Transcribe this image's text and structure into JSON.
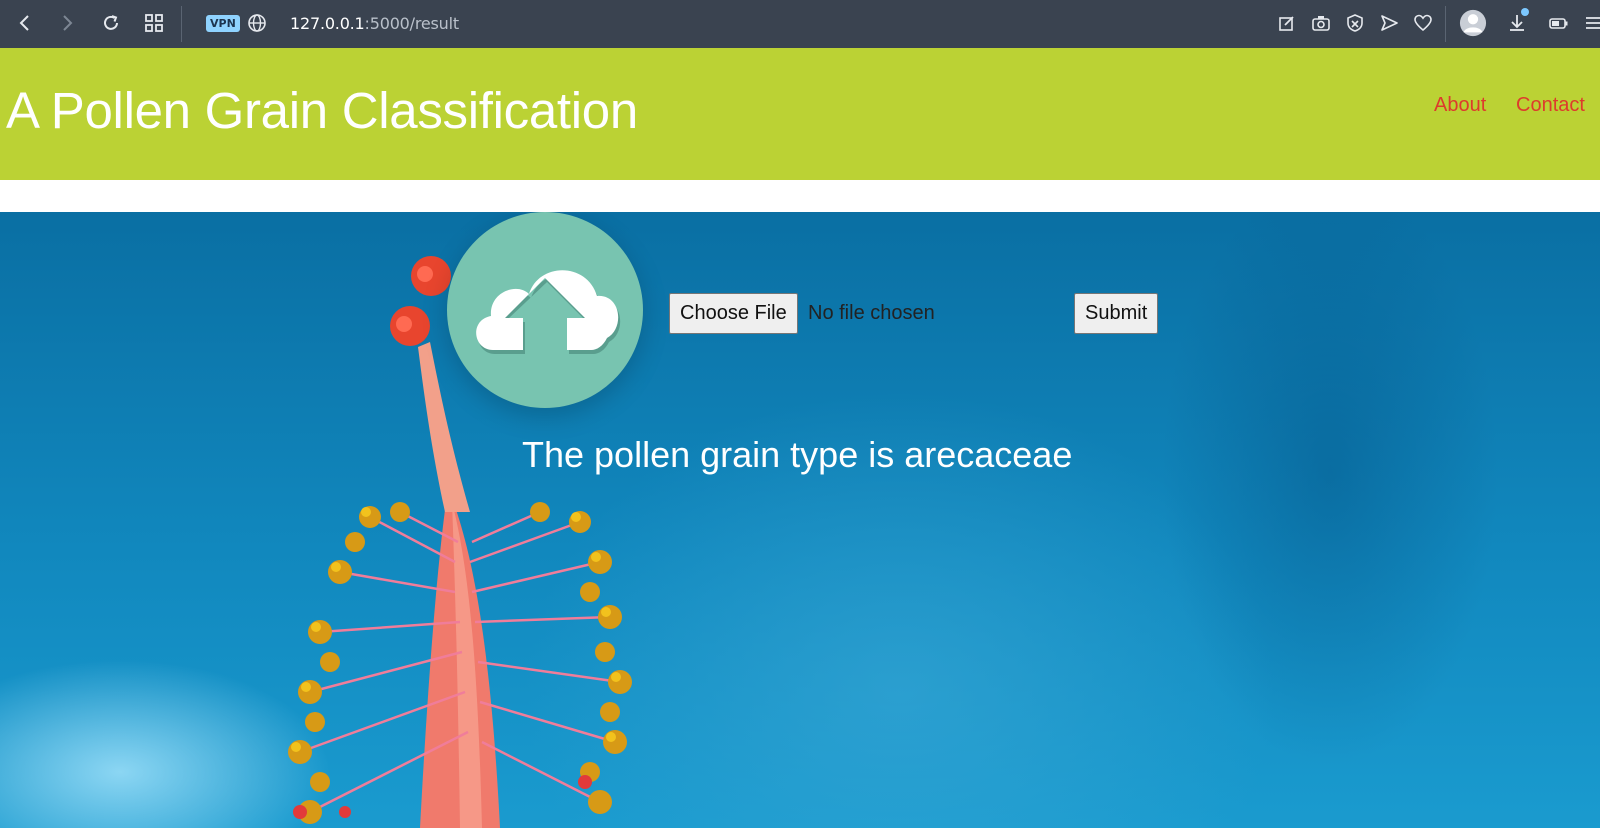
{
  "browser": {
    "vpn_label": "VPN",
    "url_host": "127.0.0.1",
    "url_rest": ":5000/result",
    "icons": [
      "back-icon",
      "forward-icon",
      "reload-icon",
      "tabs-grid-icon",
      "globe-icon",
      "edit-page-icon",
      "camera-icon",
      "shield-icon",
      "send-icon",
      "heart-icon",
      "profile-icon",
      "download-icon",
      "battery-icon",
      "menu-icon"
    ]
  },
  "site": {
    "title": "A Pollen Grain Classification",
    "nav": [
      {
        "label": "About"
      },
      {
        "label": "Contact"
      }
    ]
  },
  "upload": {
    "icon": "cloud-upload-icon",
    "choose_label": "Choose File",
    "status": "No file chosen",
    "submit_label": "Submit"
  },
  "result": {
    "text": "The pollen grain type is arecaceae"
  },
  "colors": {
    "header_bg": "#bbd234",
    "nav_link": "#dd3b2c",
    "upload_circle": "#78c4b0",
    "browser_bar": "#3a4350",
    "hero_blue": "#1188be"
  }
}
